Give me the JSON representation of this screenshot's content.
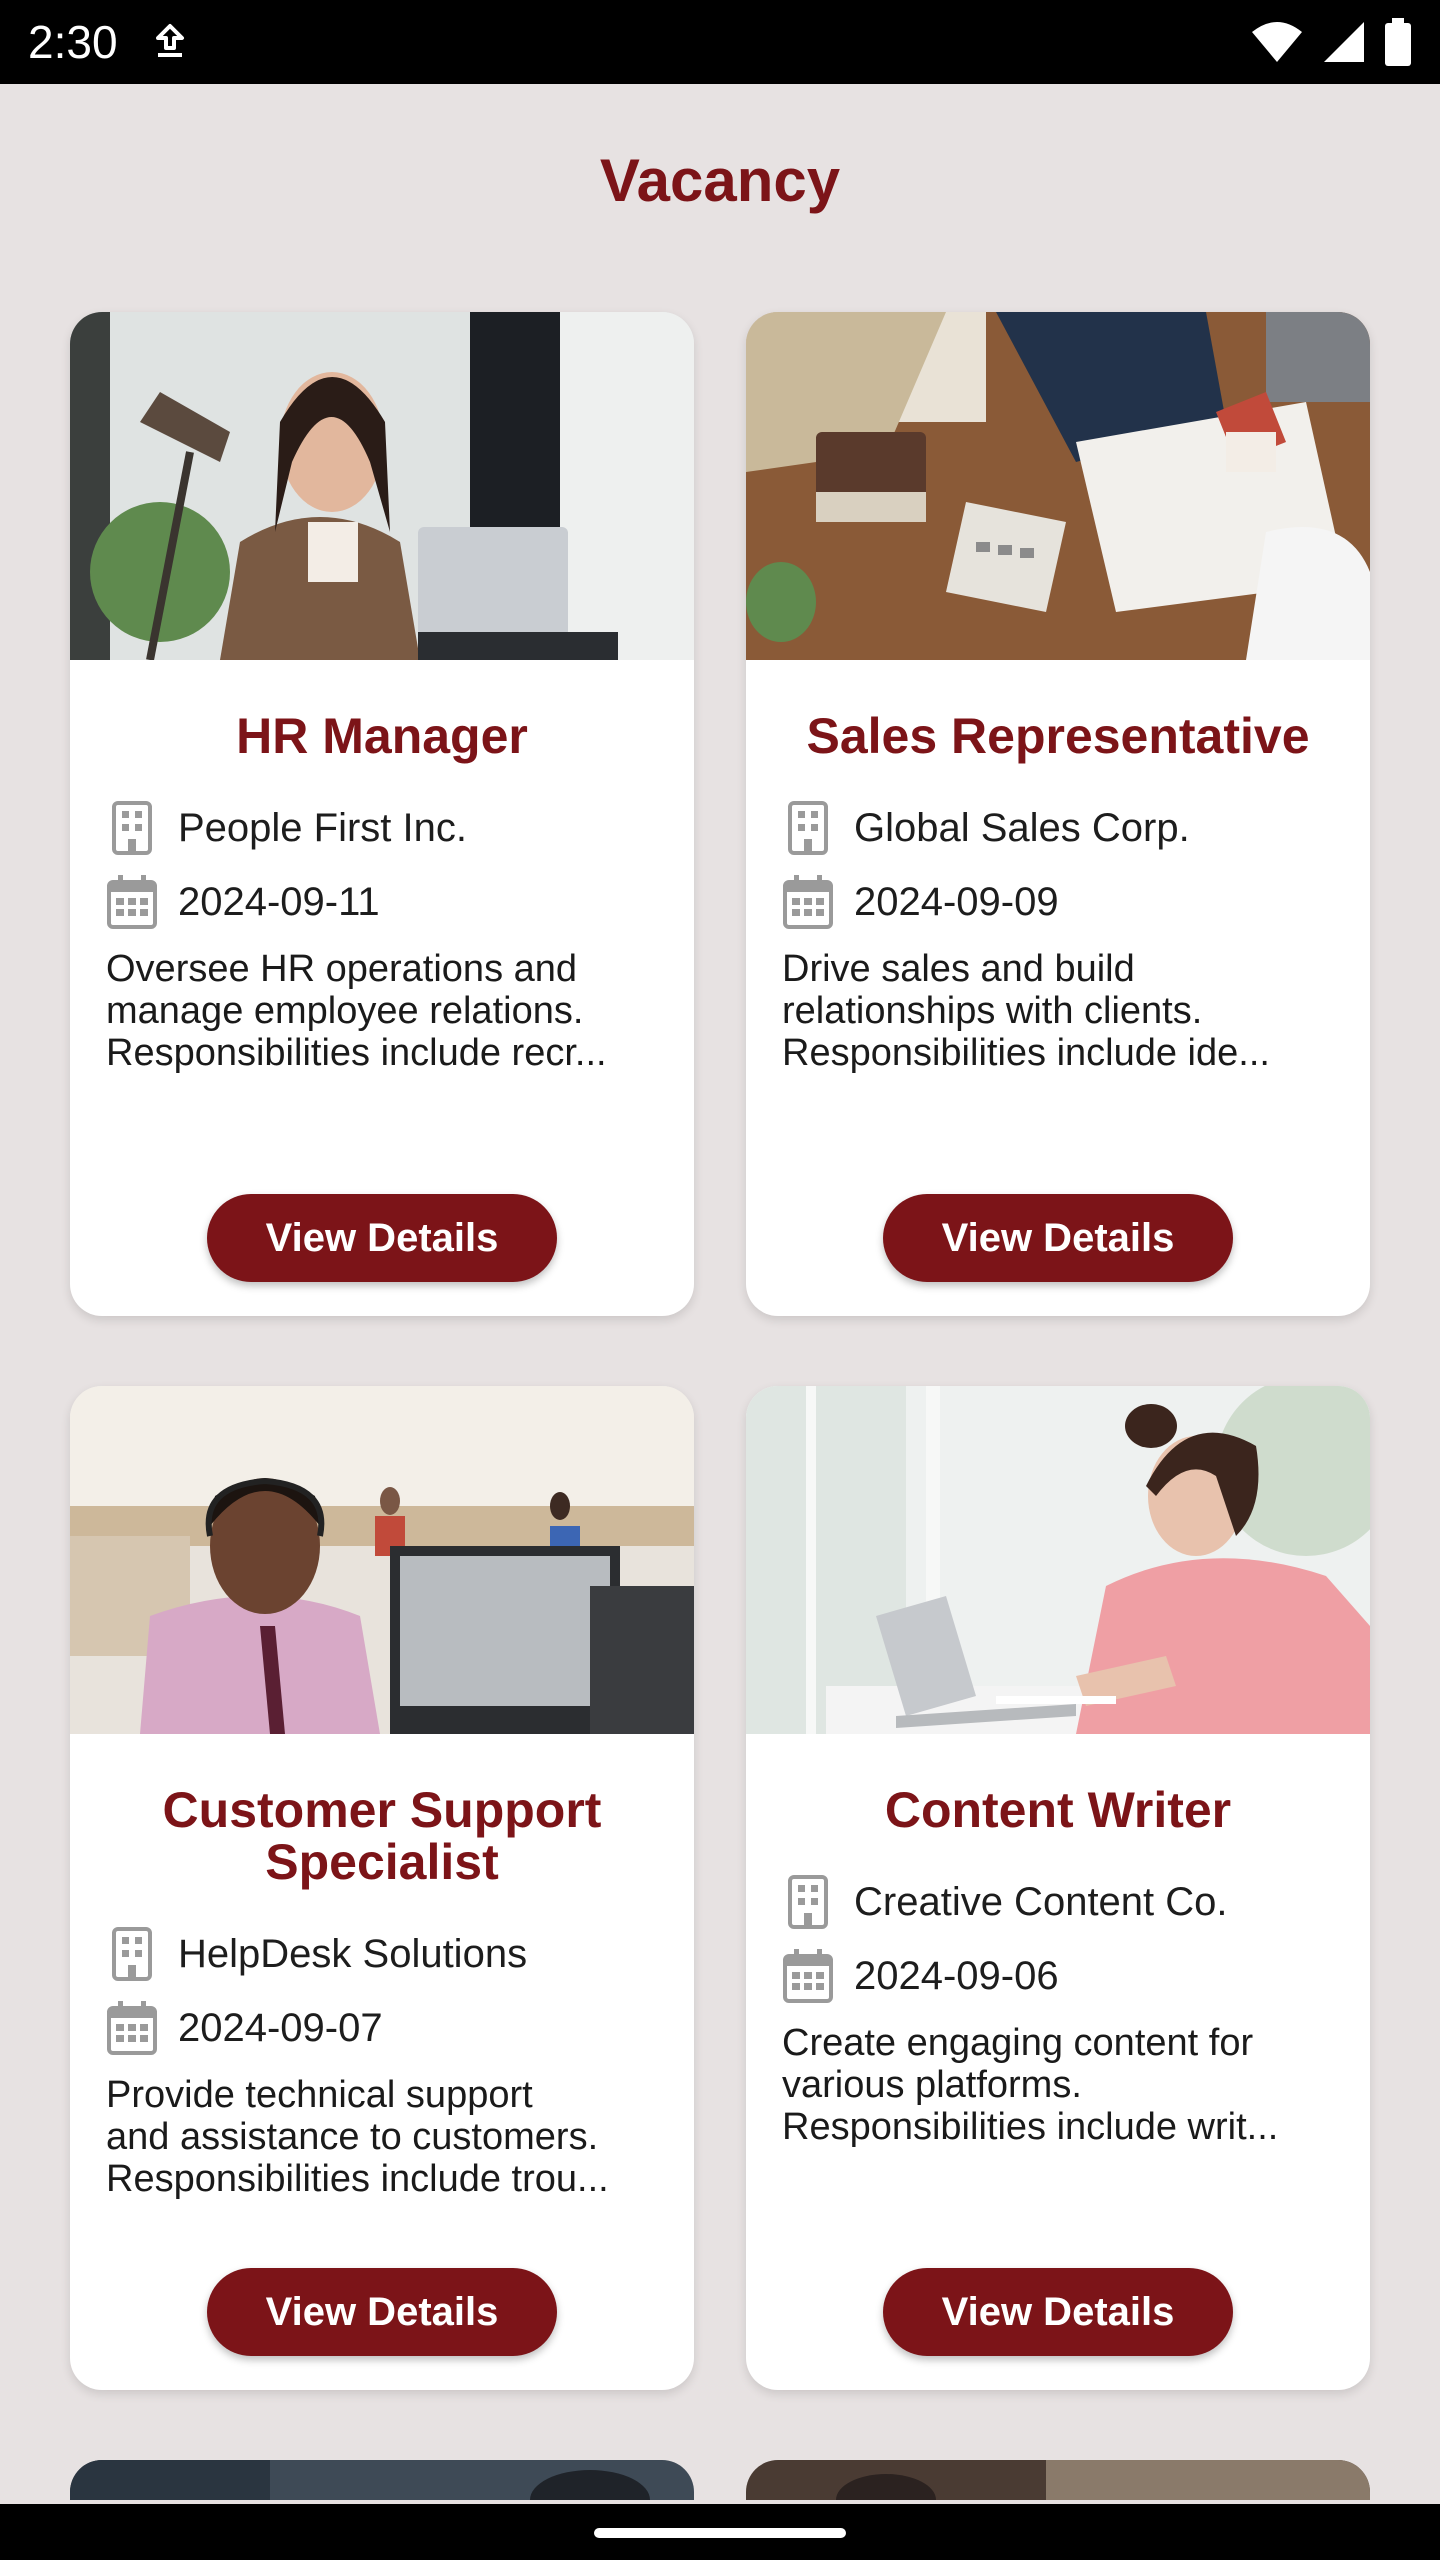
{
  "status_bar": {
    "time": "2:30",
    "icons": [
      "download-icon",
      "wifi-icon",
      "signal-icon",
      "battery-icon"
    ]
  },
  "page": {
    "title": "Vacancy"
  },
  "theme": {
    "accent": "#7c1418",
    "background": "#e7e2e2",
    "card": "#ffffff"
  },
  "jobs": [
    {
      "title": "HR Manager",
      "company": "People First Inc.",
      "date": "2024-09-11",
      "description": [
        "Oversee HR operations and",
        "manage employee relations.",
        "Responsibilities include recr..."
      ],
      "button": "View Details"
    },
    {
      "title": "Sales Representative",
      "company": "Global Sales Corp.",
      "date": "2024-09-09",
      "description": [
        "Drive sales and build",
        "relationships with clients.",
        "Responsibilities include ide..."
      ],
      "button": "View Details"
    },
    {
      "title": "Customer Support Specialist",
      "company": "HelpDesk Solutions",
      "date": "2024-09-07",
      "description": [
        "Provide technical support",
        "and assistance to customers.",
        "Responsibilities include trou..."
      ],
      "button": "View Details"
    },
    {
      "title": "Content Writer",
      "company": "Creative Content Co.",
      "date": "2024-09-06",
      "description": [
        "Create engaging content for",
        "various platforms.",
        "Responsibilities include writ..."
      ],
      "button": "View Details"
    }
  ]
}
